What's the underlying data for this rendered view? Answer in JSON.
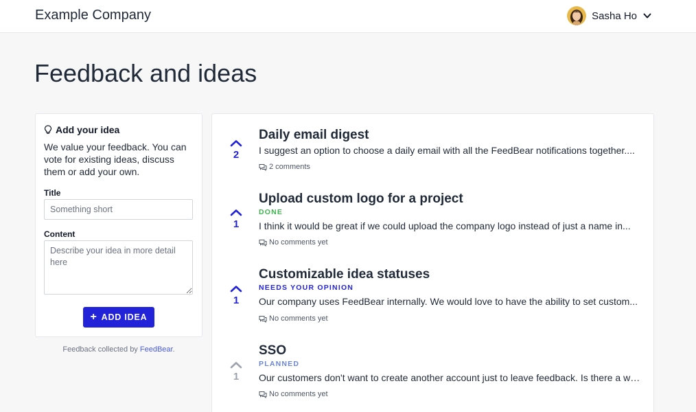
{
  "header": {
    "company": "Example Company",
    "user_name": "Sasha Ho"
  },
  "page": {
    "title": "Feedback and ideas"
  },
  "sidebar": {
    "heading": "Add your idea",
    "description": "We value your feedback. You can vote for existing ideas, discuss them or add your own.",
    "title_label": "Title",
    "title_placeholder": "Something short",
    "content_label": "Content",
    "content_placeholder": "Describe your idea in more detail here",
    "add_button": "ADD IDEA",
    "footer_text": "Feedback collected by ",
    "footer_link": "FeedBear",
    "footer_end": "."
  },
  "colors": {
    "accent": "#2222d9",
    "done": "#3fb34f",
    "needs_opinion": "#2222d9",
    "planned": "#6b86d6",
    "muted": "#9ca3af"
  },
  "ideas": [
    {
      "votes": "2",
      "title": "Daily email digest",
      "status": "",
      "description": "I suggest an option to choose a daily email with all the FeedBear notifications together....",
      "comments": "2 comments"
    },
    {
      "votes": "1",
      "title": "Upload custom logo for a project",
      "status": "DONE",
      "description": "I think it would be great if we could upload the company logo instead of just a name in...",
      "comments": "No comments yet"
    },
    {
      "votes": "1",
      "title": "Customizable idea statuses",
      "status": "NEEDS YOUR OPINION",
      "description": "Our company uses FeedBear internally. We would love to have the ability to set custom...",
      "comments": "No comments yet"
    },
    {
      "votes": "1",
      "title": "SSO",
      "status": "PLANNED",
      "description": "Our customers don't want to create another account just to leave feedback. Is there a wa...",
      "comments": "No comments yet"
    }
  ]
}
